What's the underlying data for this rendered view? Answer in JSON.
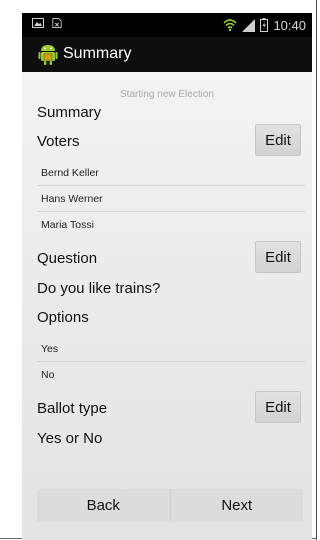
{
  "statusbar": {
    "time": "10:40",
    "icons": [
      "image-icon",
      "no-sim-icon",
      "wifi-icon",
      "signal-icon",
      "battery-charging-icon"
    ]
  },
  "actionbar": {
    "title": "Summary",
    "app_icon": "android-app-icon"
  },
  "content": {
    "subtitle": "Starting new Election",
    "summary_heading": "Summary",
    "voters": {
      "heading": "Voters",
      "edit_label": "Edit",
      "items": [
        "Bernd Keller",
        "Hans Werner",
        "Maria Tossi"
      ]
    },
    "question": {
      "heading": "Question",
      "edit_label": "Edit",
      "value": "Do you like trains?"
    },
    "options": {
      "heading": "Options",
      "items": [
        "Yes",
        "No"
      ]
    },
    "ballot_type": {
      "heading": "Ballot type",
      "edit_label": "Edit",
      "value": "Yes or No"
    }
  },
  "footer": {
    "back_label": "Back",
    "next_label": "Next"
  },
  "colors": {
    "statusbar_bg": "#000000",
    "actionbar_bg": "#0e0e0e",
    "content_bg": "#f0f0f0",
    "button_bg": "#d8d8d8"
  }
}
